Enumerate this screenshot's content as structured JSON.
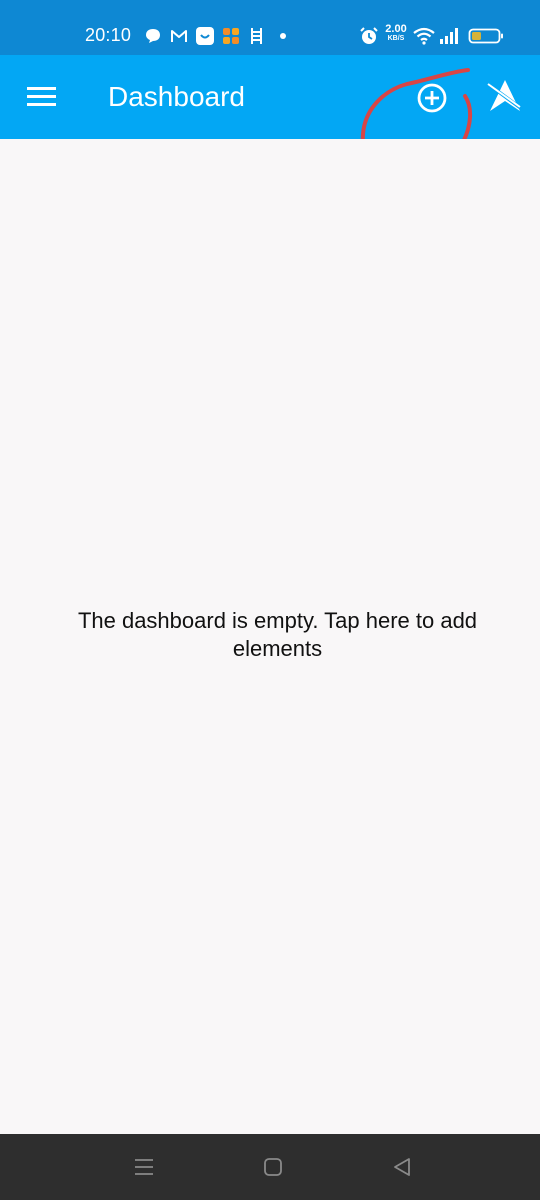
{
  "status_bar": {
    "time": "20:10",
    "net_speed_value": "2.00",
    "net_speed_unit": "KB/S",
    "icons": [
      "chat-icon",
      "gmail-icon",
      "app-smile-icon",
      "app-orange-icon",
      "ladder-icon",
      "dot-icon",
      "alarm-icon",
      "wifi-icon",
      "signal-icon",
      "battery-icon"
    ],
    "battery_color": "#d4b33a"
  },
  "app_bar": {
    "title": "Dashboard",
    "menu_icon": "hamburger-menu-icon",
    "add_icon": "add-circle-icon",
    "nav_icon": "navigation-arrow-icon",
    "color": "#03a7f4"
  },
  "annotation": {
    "color": "#d94545"
  },
  "main": {
    "empty_message": "The dashboard is empty. Tap here to add elements"
  },
  "nav_bar": {
    "items": [
      "recent-apps-icon",
      "home-icon",
      "back-icon"
    ]
  }
}
